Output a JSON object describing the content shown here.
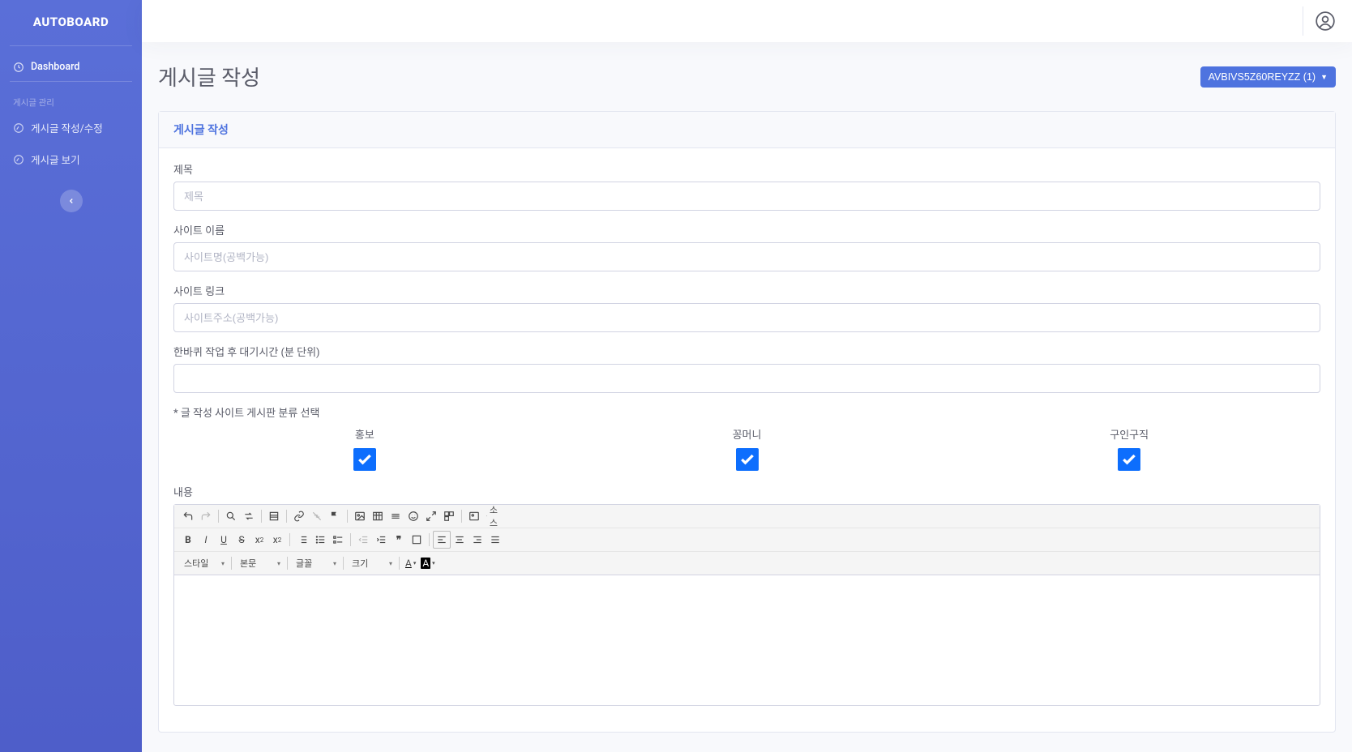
{
  "brand": "AUTOBOARD",
  "sidebar": {
    "dashboard": "Dashboard",
    "section1": "게시글 관리",
    "item_write": "게시글 작성/수정",
    "item_view": "게시글 보기"
  },
  "page": {
    "title": "게시글 작성",
    "badge": "AVBIVS5Z60REYZZ (1)"
  },
  "card": {
    "header": "게시글 작성",
    "title_label": "제목",
    "title_ph": "제목",
    "site_name_label": "사이트 이름",
    "site_name_ph": "사이트명(공백가능)",
    "site_link_label": "사이트 링크",
    "site_link_ph": "사이트주소(공백가능)",
    "wait_label": "한바퀴 작업 후 대기시간 (분 단위)",
    "category_label": "* 글 작성 사이트 게시판 분류 선택",
    "categories": {
      "c1": "홍보",
      "c2": "꽁머니",
      "c3": "구인구직"
    },
    "content_label": "내용"
  },
  "editor_combos": {
    "style": "스타일",
    "format": "본문",
    "font": "글꼴",
    "size": "크기",
    "source": "소스"
  }
}
